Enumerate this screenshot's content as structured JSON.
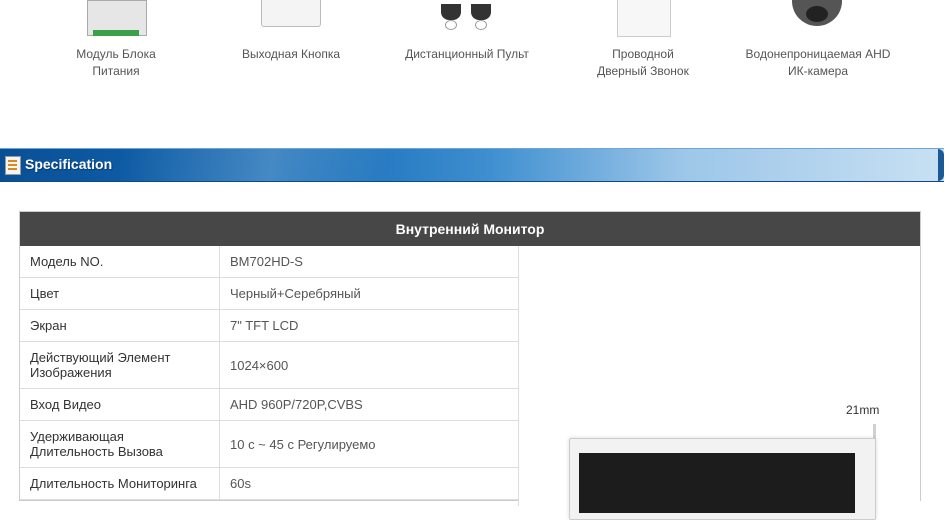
{
  "products": [
    {
      "label_line1": "Модуль Блока",
      "label_line2": "Питания"
    },
    {
      "label_line1": "Выходная Кнопка",
      "label_line2": ""
    },
    {
      "label_line1": "Дистанционный Пульт",
      "label_line2": ""
    },
    {
      "label_line1": "Проводной",
      "label_line2": "Дверный Звонок"
    },
    {
      "label_line1": "Водонепроницаемая AHD",
      "label_line2": "ИК-камера"
    }
  ],
  "spec_bar": {
    "title": "Specification",
    "accent": "#1269b5"
  },
  "table": {
    "header": "Внутренний Монитор",
    "rows": [
      {
        "key": "Модель NO.",
        "value": "BM702HD-S"
      },
      {
        "key": "Цвет",
        "value": "Черный+Серебряный"
      },
      {
        "key": "Экран",
        "value": "7\" TFT LCD"
      },
      {
        "key": "Действующий Элемент Изображения",
        "value": "1024×600"
      },
      {
        "key": "Вход Видео",
        "value": "AHD 960P/720P,CVBS"
      },
      {
        "key": "Удерживающая Длительность Вызова",
        "value": "10 с ~ 45 с Регулируемо"
      },
      {
        "key": "Длительность Мониторинга",
        "value": "60s"
      }
    ],
    "image_dimension_label": "21mm"
  }
}
